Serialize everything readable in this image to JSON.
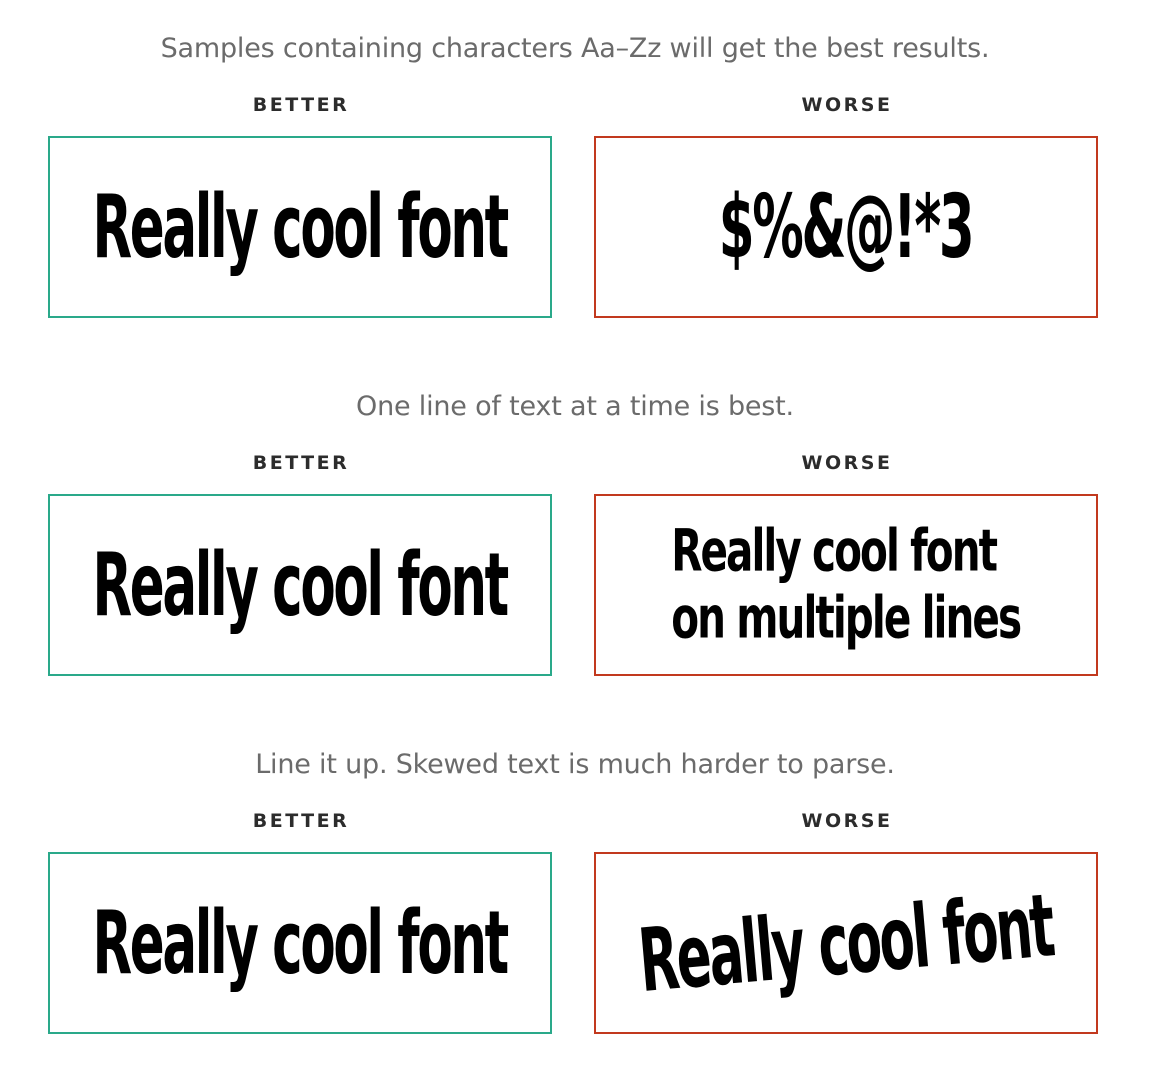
{
  "sections": [
    {
      "tip": "Samples containing characters Aa–Zz will get the best results.",
      "better_label": "BETTER",
      "worse_label": "WORSE",
      "better_sample": "Really cool font",
      "worse_sample": "$%&@!*3"
    },
    {
      "tip": "One line of text at a time is best.",
      "better_label": "BETTER",
      "worse_label": "WORSE",
      "better_sample": "Really cool font",
      "worse_sample_lines": [
        "Really cool font",
        "on multiple lines"
      ]
    },
    {
      "tip": "Line it up. Skewed text is much harder to parse.",
      "better_label": "BETTER",
      "worse_label": "WORSE",
      "better_sample": "Really cool font",
      "worse_sample": "Really cool font"
    }
  ],
  "colors": {
    "better_border": "#2aa98a",
    "worse_border": "#c2391e",
    "tip_text": "#6b6b6b",
    "label_text": "#2c2c2c"
  }
}
